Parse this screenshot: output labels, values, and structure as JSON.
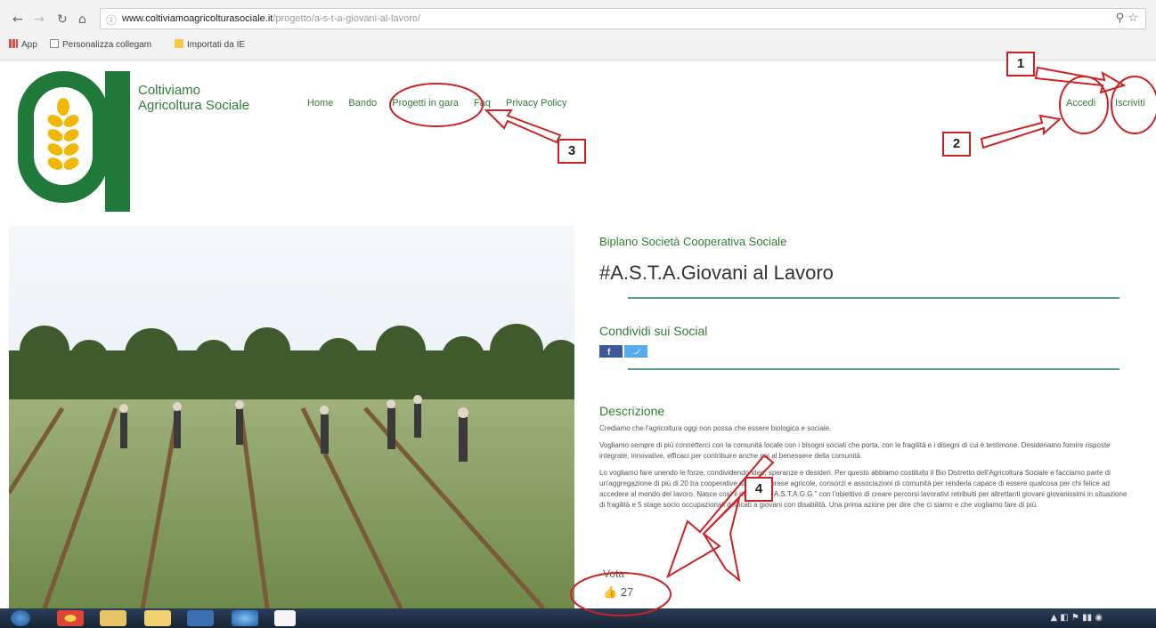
{
  "browser": {
    "url_domain": "www.coltiviamoagricolturasociale.it",
    "url_path": "/progetto/a-s-t-a-giovani-al-lavoro/",
    "bookmarks": [
      "App",
      "Personalizza collegam",
      "Importati da IE"
    ]
  },
  "site": {
    "brand_line1": "Coltiviamo",
    "brand_line2": "Agricoltura Sociale",
    "nav": [
      "Home",
      "Bando",
      "Progetti in gara",
      "Faq",
      "Privacy Policy"
    ],
    "login": "Accedi",
    "register": "Iscriviti",
    "brand_color": "#2f7d32"
  },
  "project": {
    "organization": "Biplano Società Cooperativa Sociale",
    "title": "#A.S.T.A.Giovani al Lavoro",
    "share_heading": "Condividi sui Social",
    "social": [
      "facebook-icon",
      "twitter-icon"
    ],
    "description_heading": "Descrizione",
    "description": [
      "Crediamo che l'agricoltura oggi non possa che essere biologica e sociale.",
      "Vogliamo sempre di più connetterci con la comunità locale con i bisogni sociali che porta, con le fragilità e i disegni di cui è testimone. Desideriamo fornire risposte integrate, innovative, efficaci per contribuire anche noi al benessere della comunità.",
      "Lo vogliamo fare unendo le forze, condividendo idee, speranze e desideri. Per questo abbiamo costituito il Bio Distretto dell'Agricoltura Sociale e facciamo parte di un'aggregazione di più di 20 tra cooperative sociali, imprese agricole, consorzi e associazioni di comunità per renderla capace di essere qualcosa per chi felice ad accedere al mondo del lavoro. Nasce così il progetto \"#A.S.T.A.G.G.\" con l'obiettivo di creare percorsi lavorativi retribuiti per altrettanti giovani giovanissimi in situazione di fragilità e 5 stage socio occupazionali dedicati a giovani con disabilità. Una prima azione per dire che ci siamo e che vogliamo fare di più."
    ],
    "vote_label": "Vota",
    "likes": "27"
  },
  "annotations": [
    "1",
    "2",
    "3",
    "4"
  ],
  "annotation_color": "#cc2222"
}
